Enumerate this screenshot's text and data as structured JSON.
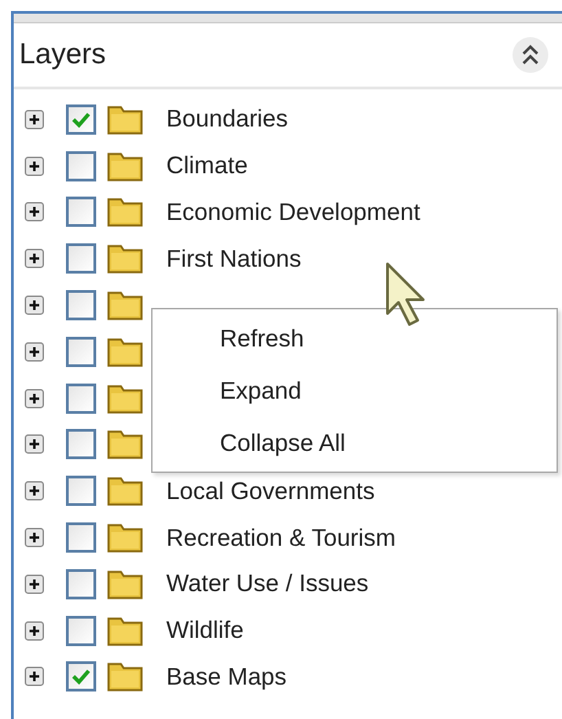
{
  "panel": {
    "title": "Layers"
  },
  "layers": [
    {
      "label": "Boundaries",
      "checked": true
    },
    {
      "label": "Climate",
      "checked": false
    },
    {
      "label": "Economic Development",
      "checked": false
    },
    {
      "label": "First Nations",
      "checked": false
    },
    {
      "checked": false
    },
    {
      "checked": false
    },
    {
      "checked": false
    },
    {
      "checked": false
    },
    {
      "label": "Local Governments",
      "checked": false
    },
    {
      "label": "Recreation & Tourism",
      "checked": false
    },
    {
      "label": "Water Use / Issues",
      "checked": false
    },
    {
      "label": "Wildlife",
      "checked": false
    },
    {
      "label": "Base Maps",
      "checked": true
    }
  ],
  "context_menu": {
    "items": [
      "Refresh",
      "Expand",
      "Collapse All"
    ]
  }
}
